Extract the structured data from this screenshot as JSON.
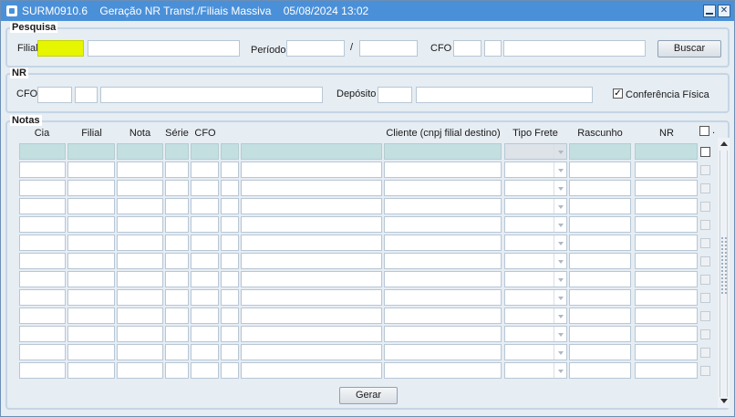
{
  "window": {
    "title": "SURM0910.6    Geração NR Transf./Filiais Massiva    05/08/2024 13:02",
    "minimize_label": "",
    "close_label": "✕"
  },
  "pesquisa": {
    "section_label": "Pesquisa",
    "filial_label": "Filial",
    "filial_code": "",
    "filial_name": "",
    "periodo_label": "Período",
    "periodo_start": "",
    "periodo_separator": "/",
    "periodo_end": "",
    "cfo_label": "CFO",
    "cfo_code": "",
    "cfo_sub": "",
    "cfo_desc": "",
    "buscar_label": "Buscar"
  },
  "nr": {
    "section_label": "NR",
    "cfo_label": "CFO",
    "cfo_code": "",
    "cfo_sub": "",
    "cfo_desc": "",
    "deposito_label": "Depósito",
    "deposito_code": "",
    "deposito_name": "",
    "conferencia_label": "Conferência Física",
    "conferencia_checked": true
  },
  "notas": {
    "section_label": "Notas",
    "columns": {
      "cia": "Cia",
      "filial": "Filial",
      "nota": "Nota",
      "serie": "Série",
      "cfo": "CFO",
      "cliente": "Cliente (cnpj filial destino)",
      "tipo_frete": "Tipo Frete",
      "rascunho": "Rascunho",
      "nr": "NR",
      "select_all_marker": "."
    },
    "row_count": 13,
    "selected_row_index": 0,
    "gerar_label": "Gerar"
  },
  "colors": {
    "titlebar": "#4a90d9",
    "required_field": "#e6f500",
    "current_row": "#c4dfe0",
    "panel_bg": "#e6edf3"
  }
}
